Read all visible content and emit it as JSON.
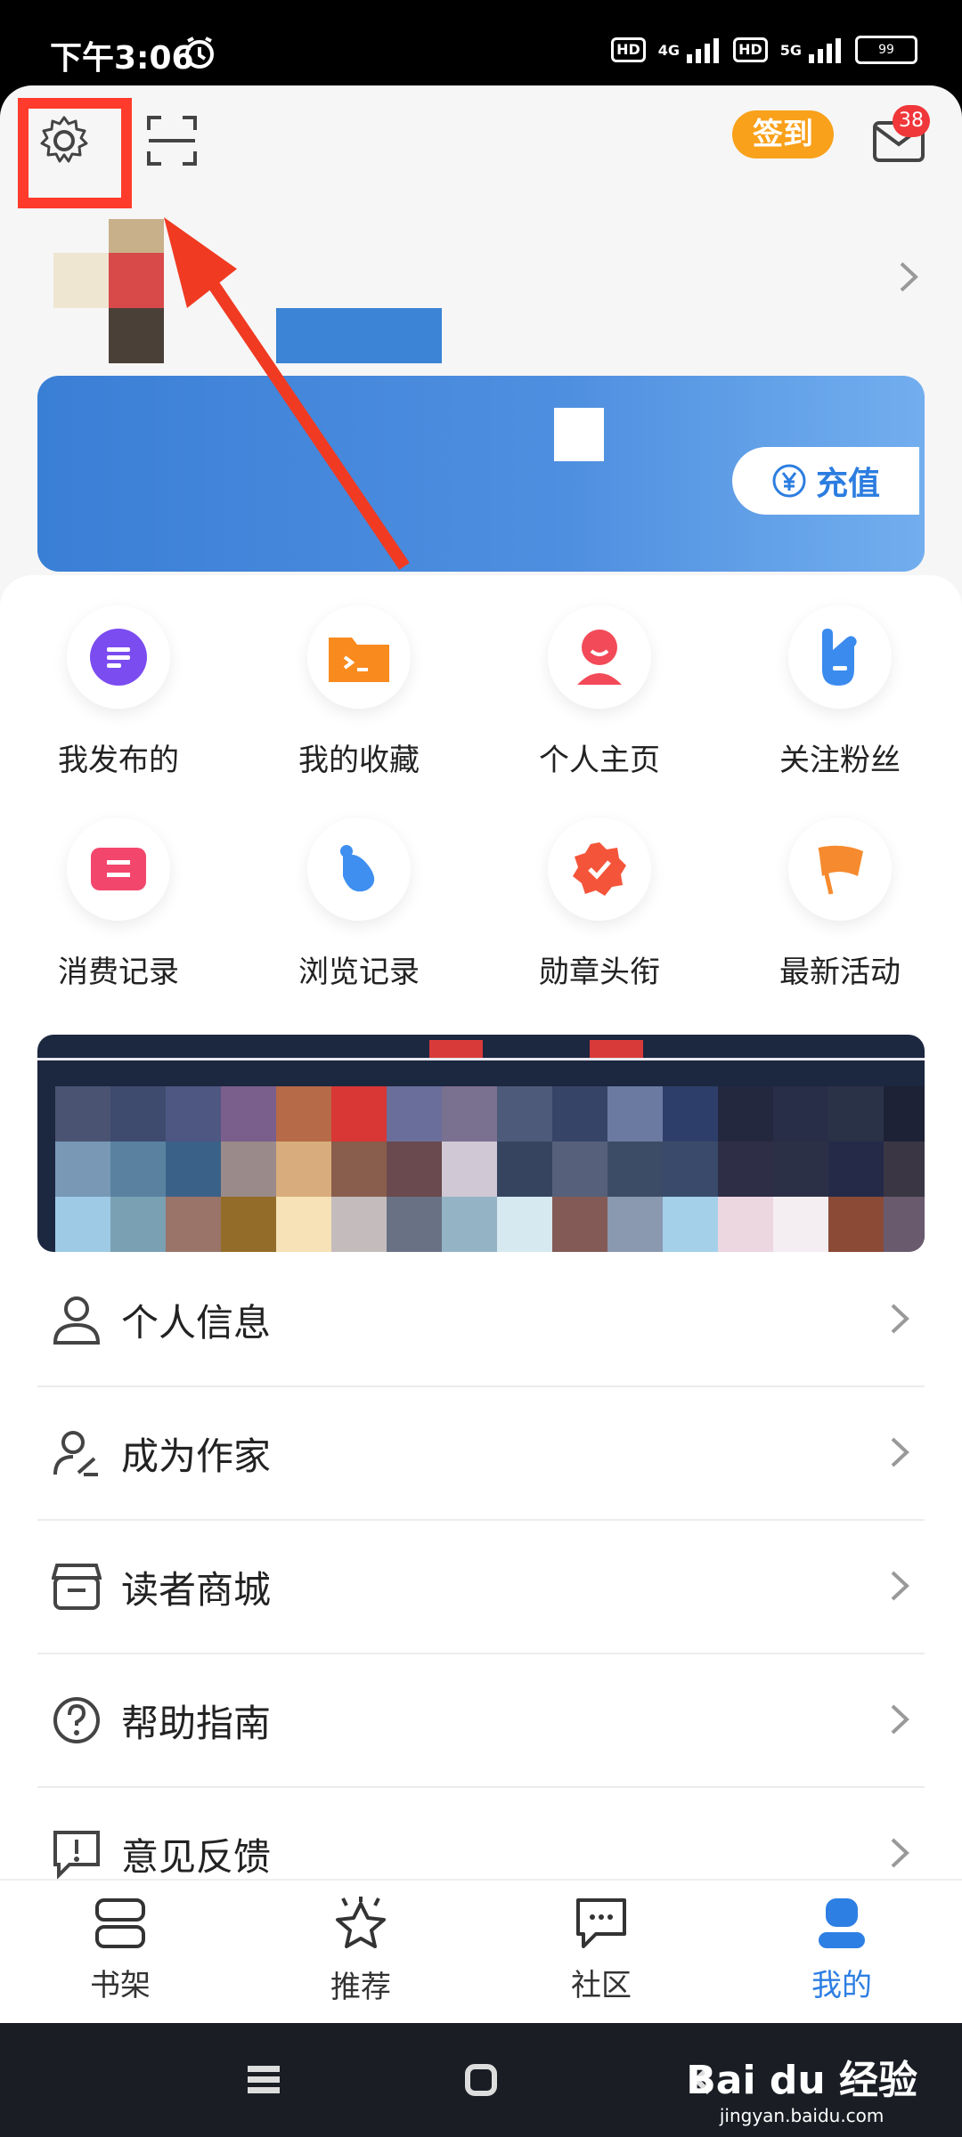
{
  "status": {
    "time": "下午3:06",
    "hd1": "HD",
    "net1": "4G",
    "hd2": "HD",
    "net2": "5G",
    "battery": "99"
  },
  "header": {
    "checkin_label": "签到",
    "mail_badge": "38",
    "recharge_label": "充值"
  },
  "grid": [
    {
      "label": "我发布的",
      "icon": "post-icon",
      "color": "#7b4cf0"
    },
    {
      "label": "我的收藏",
      "icon": "folder-icon",
      "color": "#f98a1d"
    },
    {
      "label": "个人主页",
      "icon": "person-icon",
      "color": "#f24a58"
    },
    {
      "label": "关注粉丝",
      "icon": "hand-icon",
      "color": "#3b8bef"
    },
    {
      "label": "消费记录",
      "icon": "ticket-icon",
      "color": "#f3466d"
    },
    {
      "label": "浏览记录",
      "icon": "browse-icon",
      "color": "#3e8ff0"
    },
    {
      "label": "勋章头衔",
      "icon": "medal-icon",
      "color": "#f4553a"
    },
    {
      "label": "最新活动",
      "icon": "flag-icon",
      "color": "#f68a2e"
    }
  ],
  "menu": [
    {
      "label": "个人信息",
      "icon": "user-icon"
    },
    {
      "label": "成为作家",
      "icon": "writer-icon"
    },
    {
      "label": "读者商城",
      "icon": "store-icon"
    },
    {
      "label": "帮助指南",
      "icon": "help-icon"
    },
    {
      "label": "意见反馈",
      "icon": "feedback-icon"
    }
  ],
  "tabs": [
    {
      "label": "书架",
      "icon": "bookshelf-icon"
    },
    {
      "label": "推荐",
      "icon": "star-icon"
    },
    {
      "label": "社区",
      "icon": "chat-icon"
    },
    {
      "label": "我的",
      "icon": "profile-icon",
      "active": true
    }
  ],
  "watermark": {
    "logo": "Bai du 经验",
    "url": "jingyan.baidu.com"
  }
}
